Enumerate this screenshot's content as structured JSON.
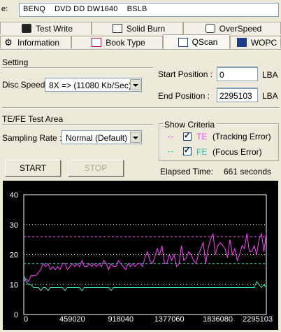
{
  "drive": {
    "prefix": "e:",
    "name": "BENQ    DVD DD DW1640    BSLB"
  },
  "tabs_row1": [
    {
      "label": "Test Write",
      "icon": "test-write-icon"
    },
    {
      "label": "Solid Burn",
      "icon": "solid-burn-icon"
    },
    {
      "label": "OverSpeed",
      "icon": "overspeed-icon"
    }
  ],
  "tabs_row2": [
    {
      "label": "Information",
      "icon": "gear-icon"
    },
    {
      "label": "Book Type",
      "icon": "book-type-icon"
    },
    {
      "label": "QScan",
      "icon": "qscan-icon",
      "active": true
    },
    {
      "label": "WOPC",
      "icon": "wopc-icon"
    }
  ],
  "setting": {
    "title": "Setting",
    "disc_speed_label": "Disc Speed:",
    "disc_speed_value": "8X => (11080 Kb/Sec)",
    "start_label": "Start Position :",
    "start_value": "0",
    "start_unit": "LBA",
    "end_label": "End Position :",
    "end_value": "2295103",
    "end_unit": "LBA"
  },
  "test_area": {
    "title": "TE/FE Test Area",
    "sampling_label": "Sampling Rate :",
    "sampling_value": "Normal (Default)"
  },
  "criteria": {
    "title": "Show Criteria",
    "te_code": "TE",
    "te_desc": "(Tracking Error)",
    "fe_code": "FE",
    "fe_desc": "(Focus Error)",
    "te_checked": true,
    "fe_checked": true
  },
  "buttons": {
    "start": "START",
    "stop": "STOP"
  },
  "elapsed": {
    "label": "Elapsed Time:",
    "value": "661 seconds"
  },
  "colors": {
    "te": "#ff40ff",
    "fe": "#30e0c0",
    "chart_bg": "#000000"
  },
  "chart_data": {
    "type": "line",
    "xlim": [
      0,
      2295103
    ],
    "ylim": [
      0,
      40
    ],
    "yticks": [
      "0",
      "10",
      "20",
      "30",
      "40"
    ],
    "xticks": [
      "0",
      "459020",
      "918040",
      "1377060",
      "1836080",
      "2295103"
    ],
    "xtick_values": [
      0,
      459020,
      918040,
      1377060,
      1836080,
      2295103
    ],
    "te_limit": 26,
    "fe_limit": 17,
    "grid_lines": [
      10,
      20,
      30
    ],
    "series": [
      {
        "key": "TE",
        "values": [
          11,
          12,
          11,
          13,
          13,
          13,
          14,
          15,
          17,
          16,
          17,
          15,
          16,
          15,
          16,
          15,
          17,
          17,
          15,
          16,
          17,
          16,
          17,
          16,
          18,
          16,
          16,
          17,
          16,
          17,
          16,
          17,
          16,
          18,
          17,
          15,
          17,
          16,
          16,
          18,
          17,
          16,
          15,
          17,
          16,
          17,
          16,
          17,
          17,
          16,
          19,
          21,
          18,
          17,
          19,
          22,
          20,
          23,
          17,
          17,
          20,
          18,
          20,
          16,
          17,
          23,
          18,
          19,
          21,
          20,
          18,
          17,
          20,
          22,
          24,
          17,
          22,
          25,
          27,
          20,
          23,
          24,
          23,
          22,
          19,
          25,
          20,
          22,
          18,
          20,
          23,
          22,
          27,
          21,
          21,
          23,
          20,
          25,
          27,
          21,
          27
        ]
      },
      {
        "key": "FE",
        "values": [
          13,
          11,
          10,
          10,
          9,
          9,
          9,
          8,
          9,
          9,
          8,
          9,
          9,
          9,
          9,
          9,
          9,
          8,
          9,
          9,
          9,
          9,
          9,
          9,
          8,
          9,
          9,
          9,
          9,
          9,
          9,
          9,
          9,
          9,
          9,
          9,
          8,
          9,
          9,
          9,
          9,
          9,
          9,
          9,
          9,
          9,
          9,
          9,
          9,
          9,
          9,
          9,
          9,
          9,
          9,
          9,
          9,
          9,
          9,
          9,
          9,
          9,
          9,
          9,
          9,
          9,
          9,
          9,
          9,
          9,
          9,
          9,
          9,
          9,
          9,
          9,
          9,
          9,
          9,
          9,
          9,
          9,
          9,
          9,
          9,
          9,
          9,
          9,
          9,
          9,
          9,
          9,
          9,
          9,
          9,
          9,
          11,
          10,
          9,
          10,
          9
        ]
      }
    ]
  }
}
